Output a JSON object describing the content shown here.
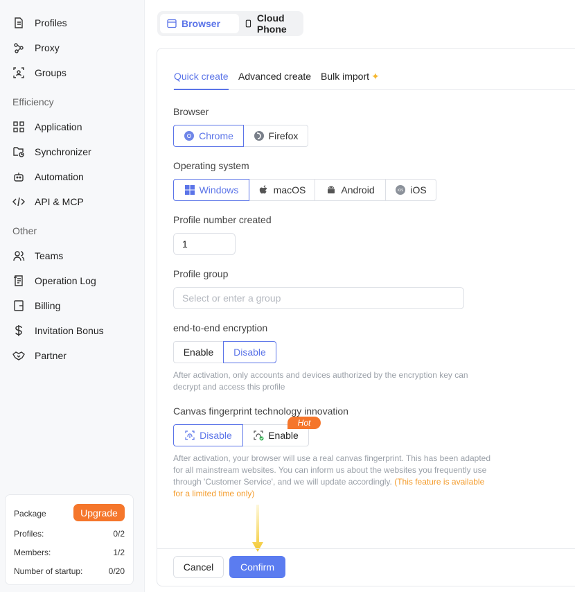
{
  "sidebar": {
    "items_top": [
      {
        "label": "Profiles",
        "icon": "document-icon"
      },
      {
        "label": "Proxy",
        "icon": "proxy-icon"
      },
      {
        "label": "Groups",
        "icon": "groups-icon"
      }
    ],
    "section_efficiency": "Efficiency",
    "items_efficiency": [
      {
        "label": "Application",
        "icon": "grid-icon"
      },
      {
        "label": "Synchronizer",
        "icon": "sync-icon"
      },
      {
        "label": "Automation",
        "icon": "robot-icon"
      },
      {
        "label": "API & MCP",
        "icon": "code-icon"
      }
    ],
    "section_other": "Other",
    "items_other": [
      {
        "label": "Teams",
        "icon": "users-icon"
      },
      {
        "label": "Operation Log",
        "icon": "log-icon"
      },
      {
        "label": "Billing",
        "icon": "wallet-icon"
      },
      {
        "label": "Invitation Bonus",
        "icon": "dollar-icon"
      },
      {
        "label": "Partner",
        "icon": "handshake-icon"
      }
    ],
    "package": {
      "title": "Package",
      "upgrade": "Upgrade",
      "rows": [
        {
          "label": "Profiles:",
          "value": "0/2"
        },
        {
          "label": "Members:",
          "value": "1/2"
        },
        {
          "label": "Number of startup:",
          "value": "0/20"
        }
      ]
    }
  },
  "topswitch": {
    "browser": "Browser",
    "cloud_phone": "Cloud Phone"
  },
  "tabs": {
    "quick": "Quick create",
    "advanced": "Advanced create",
    "bulk": "Bulk import",
    "bulk_icon": "✦"
  },
  "form": {
    "browser_label": "Browser",
    "browsers": [
      "Chrome",
      "Firefox"
    ],
    "os_label": "Operating system",
    "os_options": [
      "Windows",
      "macOS",
      "Android",
      "iOS"
    ],
    "profile_number_label": "Profile number created",
    "profile_number_value": "1",
    "group_label": "Profile group",
    "group_placeholder": "Select or enter a group",
    "e2e_label": "end-to-end encryption",
    "e2e_options": [
      "Enable",
      "Disable"
    ],
    "e2e_hint_1": "After activation, only accounts and devices authorized by the encryption key can",
    "e2e_hint_2": "decrypt and access this profile",
    "canvas_label": "Canvas fingerprint technology innovation",
    "canvas_options": [
      "Disable",
      "Enable"
    ],
    "hot_badge": "Hot",
    "canvas_hint_1": "After activation, your browser will use a real canvas fingerprint. This has been adapted",
    "canvas_hint_2": "for all mainstream websites. You can inform us about the websites you frequently use",
    "canvas_hint_3": "through 'Customer Service', and we will update accordingly.",
    "canvas_hint_orange_1": "(This feature is available",
    "canvas_hint_orange_2": "for a limited time only)"
  },
  "footer": {
    "cancel": "Cancel",
    "confirm": "Confirm"
  },
  "colors": {
    "accent": "#5b74e8",
    "orange": "#f5762b",
    "confirm": "#5b7cf0"
  }
}
